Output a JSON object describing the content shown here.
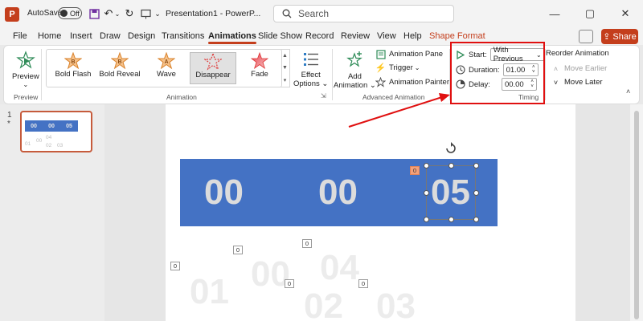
{
  "titlebar": {
    "app_letter": "P",
    "autosave_label": "AutoSave",
    "autosave_state": "Off",
    "doc_title": "Presentation1 - PowerP...",
    "search_placeholder": "Search"
  },
  "tabs": [
    {
      "label": "File"
    },
    {
      "label": "Home"
    },
    {
      "label": "Insert"
    },
    {
      "label": "Draw"
    },
    {
      "label": "Design"
    },
    {
      "label": "Transitions"
    },
    {
      "label": "Animations"
    },
    {
      "label": "Slide Show"
    },
    {
      "label": "Record"
    },
    {
      "label": "Review"
    },
    {
      "label": "View"
    },
    {
      "label": "Help"
    },
    {
      "label": "Shape Format"
    }
  ],
  "share_label": "Share",
  "ribbon": {
    "preview": {
      "label": "Preview",
      "group": "Preview"
    },
    "animation_gallery": [
      {
        "label": "Bold Flash"
      },
      {
        "label": "Bold Reveal"
      },
      {
        "label": "Wave"
      },
      {
        "label": "Disappear"
      },
      {
        "label": "Fade"
      }
    ],
    "effect_options": {
      "line1": "Effect",
      "line2": "Options"
    },
    "animation_group": "Animation",
    "add_animation": {
      "line1": "Add",
      "line2": "Animation"
    },
    "animation_pane": "Animation Pane",
    "trigger": "Trigger",
    "animation_painter": "Animation Painter",
    "advanced_group": "Advanced Animation",
    "timing": {
      "start_label": "Start:",
      "start_value": "With Previous",
      "duration_label": "Duration:",
      "duration_value": "01.00",
      "delay_label": "Delay:",
      "delay_value": "00.00",
      "group": "Timing"
    },
    "reorder": {
      "title": "Reorder Animation",
      "move_earlier": "Move Earlier",
      "move_later": "Move Later"
    }
  },
  "slides_pane": {
    "slide_number": "1",
    "slide_marker": "*",
    "thumb_numbers": [
      "00",
      "00",
      "05"
    ],
    "thumb_ghost": [
      "01",
      "00",
      "04",
      "02",
      "03"
    ]
  },
  "slide": {
    "numbers": [
      "00",
      "00",
      "05"
    ],
    "selected_tag": "0",
    "ghost_numbers": [
      "01",
      "00",
      "04",
      "02",
      "03"
    ],
    "ghost_tags": [
      "0",
      "0",
      "0",
      "0",
      "0"
    ]
  },
  "colors": {
    "accent": "#c43e1c",
    "bar": "#4472c4",
    "highlight": "#e01010"
  }
}
